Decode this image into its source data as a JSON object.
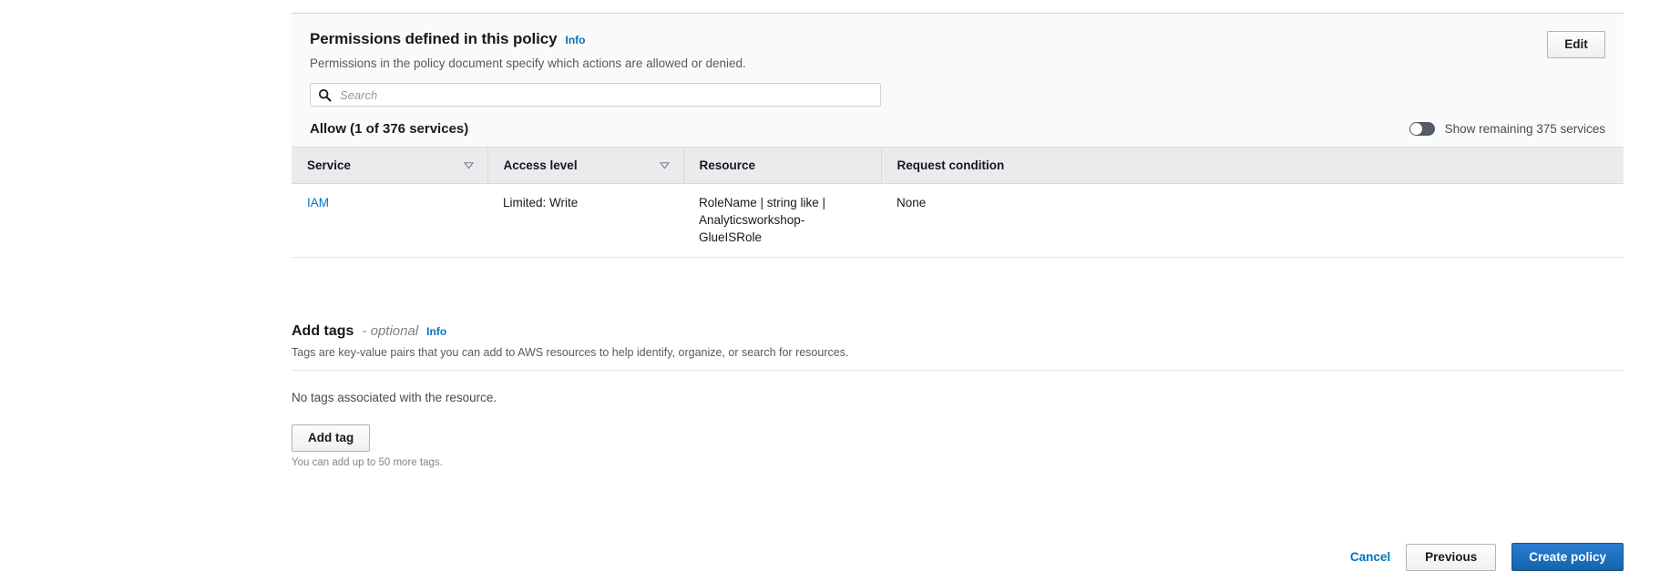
{
  "permissions_panel": {
    "title": "Permissions defined in this policy",
    "info_label": "Info",
    "description": "Permissions in the policy document specify which actions are allowed or denied.",
    "edit_label": "Edit",
    "search": {
      "placeholder": "Search",
      "value": "",
      "icon": "search-icon"
    },
    "allow_label": "Allow (1 of 376 services)",
    "toggle": {
      "label": "Show remaining 375 services",
      "state": "off"
    },
    "table": {
      "columns": [
        {
          "header": "Service",
          "sortable": true
        },
        {
          "header": "Access level",
          "sortable": true
        },
        {
          "header": "Resource",
          "sortable": false
        },
        {
          "header": "Request condition",
          "sortable": false
        }
      ],
      "rows": [
        {
          "service": "IAM",
          "access_level": "Limited: Write",
          "resource": "RoleName | string like | Analyticsworkshop-GlueISRole",
          "request_condition": "None"
        }
      ]
    }
  },
  "add_tags": {
    "title": "Add tags",
    "optional_suffix": "- optional",
    "info_label": "Info",
    "description": "Tags are key-value pairs that you can add to AWS resources to help identify, organize, or search for resources.",
    "empty_message": "No tags associated with the resource.",
    "add_tag_label": "Add tag",
    "hint": "You can add up to 50 more tags."
  },
  "footer": {
    "cancel_label": "Cancel",
    "previous_label": "Previous",
    "create_label": "Create policy"
  },
  "colors": {
    "link": "#0073bb",
    "primary_button": "#1464ab",
    "panel_background": "#fafafa",
    "table_header": "#e9ebed",
    "toggle_off_track": "#545b64"
  }
}
